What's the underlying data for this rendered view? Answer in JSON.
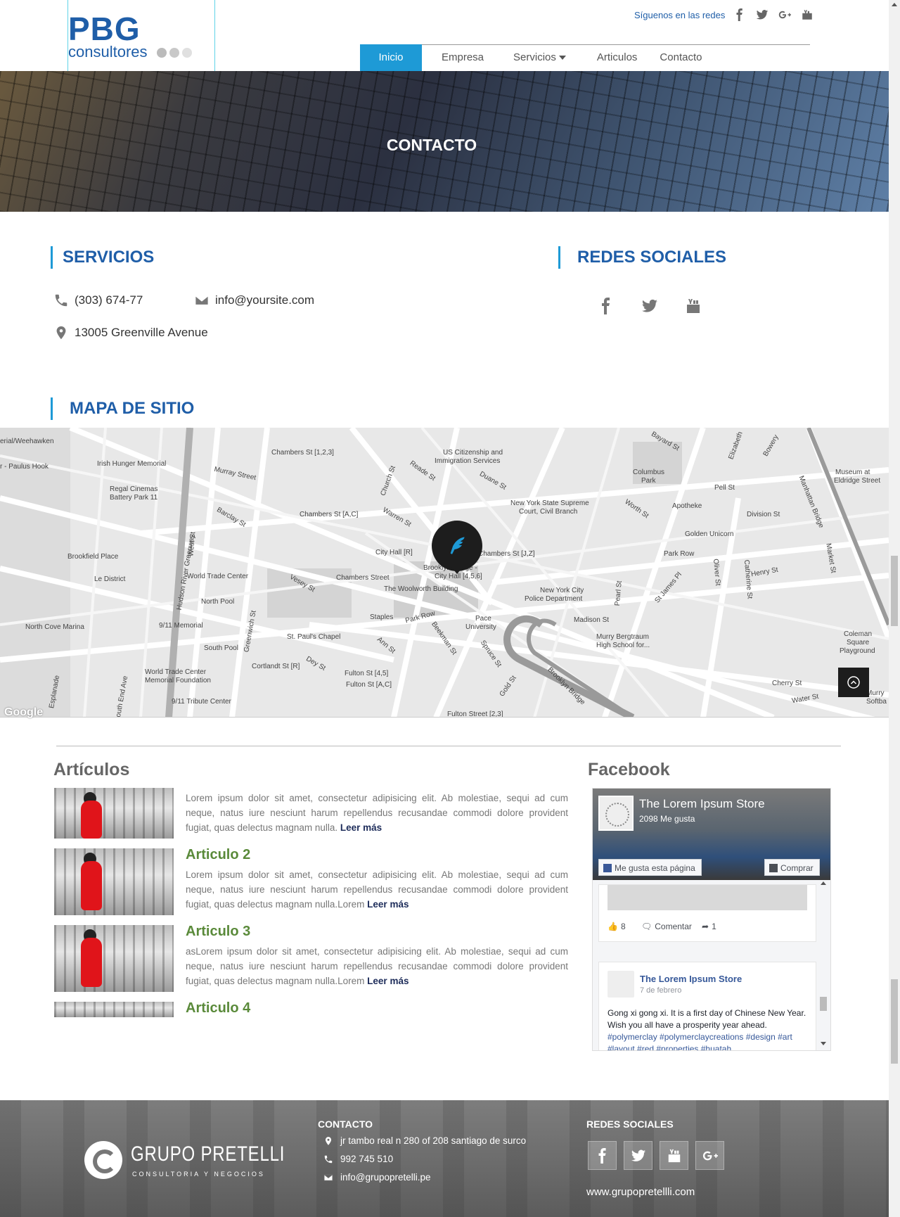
{
  "header": {
    "logo_main": "PBG",
    "logo_sub": "consultores",
    "follow_label": "Síguenos en las redes",
    "follow_icons": [
      "facebook-icon",
      "twitter-icon",
      "google-plus-icon",
      "youtube-icon"
    ],
    "nav": [
      {
        "label": "Inicio",
        "active": true
      },
      {
        "label": "Empresa",
        "active": false
      },
      {
        "label": "Servicios",
        "active": false,
        "dropdown": true
      },
      {
        "label": "Articulos",
        "active": false
      },
      {
        "label": "Contacto",
        "active": false
      }
    ]
  },
  "hero": {
    "title": "CONTACTO"
  },
  "servicios": {
    "title": "SERVICIOS",
    "phone": "(303) 674-77",
    "email": "info@yoursite.com",
    "address": "13005 Greenville Avenue"
  },
  "redes": {
    "title": "REDES SOCIALES",
    "icons": [
      "facebook-icon",
      "twitter-icon",
      "youtube-icon"
    ]
  },
  "mapa": {
    "title": "MAPA DE SITIO",
    "google": "Google",
    "labels": [
      "Chambers St [1,2,3]",
      "US Citizenship and",
      "Immigration Services",
      "Reade St",
      "Duane St",
      "Murray Street",
      "Irish Hunger Memorial",
      "Regal Cinemas",
      "Battery Park 11",
      "Barclay St",
      "Chambers St [A,C]",
      "Warren St",
      "Church St",
      "New York State Supreme",
      "Court, Civil Branch",
      "Worth St",
      "Columbus",
      "Park",
      "Pell St",
      "Division St",
      "Museum at",
      "Eldridge Street",
      "Apotheke",
      "Golden Unicorn",
      "Park Row",
      "City Hall [R]",
      "Chambers St [J,Z]",
      "Brooklyn Bridge -",
      "City Hall [4,5,6]",
      "Brookfield Place",
      "World Trade Center",
      "Chambers Street",
      "The Woolworth Building",
      "Le District",
      "North Pool",
      "Vesey St",
      "Staples",
      "Park Row",
      "Pace",
      "University",
      "New York City",
      "Police Department",
      "Pearl St",
      "Oliver St",
      "Catherine St",
      "Henry St",
      "Madison St",
      "North Cove Marina",
      "9/11 Memorial",
      "South Pool",
      "St. Paul's Chapel",
      "Ann St",
      "Beekman St",
      "Spruce St",
      "Murry Bergtraum",
      "High School for...",
      "Cortlandt St [R]",
      "Dey St",
      "Fulton St [4,5]",
      "Fulton St [A,C]",
      "World Trade Center",
      "Memorial Foundation",
      "9/11 Tribute Center",
      "Gold St",
      "Brooklyn Bridge",
      "Cherry St",
      "Water St",
      "Coleman",
      "Square",
      "Playground",
      "Manhattan Bridge",
      "Market St",
      "Bayard St",
      "Elizabeth",
      "Bowery",
      "West St",
      "Greenwich St",
      "Hudson River Greenway",
      "South End Ave",
      "Esplanade",
      "St James Pl",
      "Fulton Street [2,3]",
      "erial/Weehawken",
      "r - Paulus Hook",
      "Murry",
      "Softba"
    ]
  },
  "articulos": {
    "title": "Artículos",
    "items": [
      {
        "title": "",
        "text": "Lorem ipsum dolor sit amet, consectetur adipisicing elit. Ab molestiae, sequi ad cum neque, natus iure nesciunt harum repellendus recusandae commodi dolore provident fugiat, quas delectus magnam nulla.",
        "more": "Leer más"
      },
      {
        "title": "Articulo 2",
        "text": "Lorem ipsum dolor sit amet, consectetur adipisicing elit. Ab molestiae, sequi ad cum neque, natus iure nesciunt harum repellendus recusandae commodi dolore provident fugiat, quas delectus magnam nulla.Lorem",
        "more": "Leer más"
      },
      {
        "title": "Articulo 3",
        "text": "asLorem ipsum dolor sit amet, consectetur adipisicing elit. Ab molestiae, sequi ad cum neque, natus iure nesciunt harum repellendus recusandae commodi dolore provident fugiat, quas delectus magnam nulla.Lorem",
        "more": "Leer más"
      },
      {
        "title": "Articulo 4",
        "text": "",
        "more": ""
      }
    ]
  },
  "facebook": {
    "title": "Facebook",
    "page_name": "The Lorem Ipsum Store",
    "likes": "2098 Me gusta",
    "like_button": "Me gusta esta página",
    "buy_button": "Comprar",
    "post1": {
      "likes": "8",
      "comment": "Comentar",
      "shares": "1"
    },
    "post2": {
      "name": "The Lorem Ipsum Store",
      "date": "7 de febrero",
      "text": "Gong xi gong xi. It is a first day of Chinese New Year. Wish you all have a prosperity year ahead.",
      "tags": "#polymerclay #polymerclaycreations #design #art #layout #red #properties #huatah"
    }
  },
  "footer": {
    "brand": "GRUPO PRETELLI",
    "tagline": "CONSULTORIA Y NEGOCIOS",
    "contacto_title": "CONTACTO",
    "address": "jr tambo real n 280 of 208 santiago de surco",
    "phone": "992 745 510",
    "email": "info@grupopretelli.pe",
    "redes_title": "REDES SOCIALES",
    "icons": [
      "facebook-icon",
      "twitter-icon",
      "youtube-icon",
      "google-plus-icon"
    ],
    "website": "www.grupopretellli.com"
  }
}
